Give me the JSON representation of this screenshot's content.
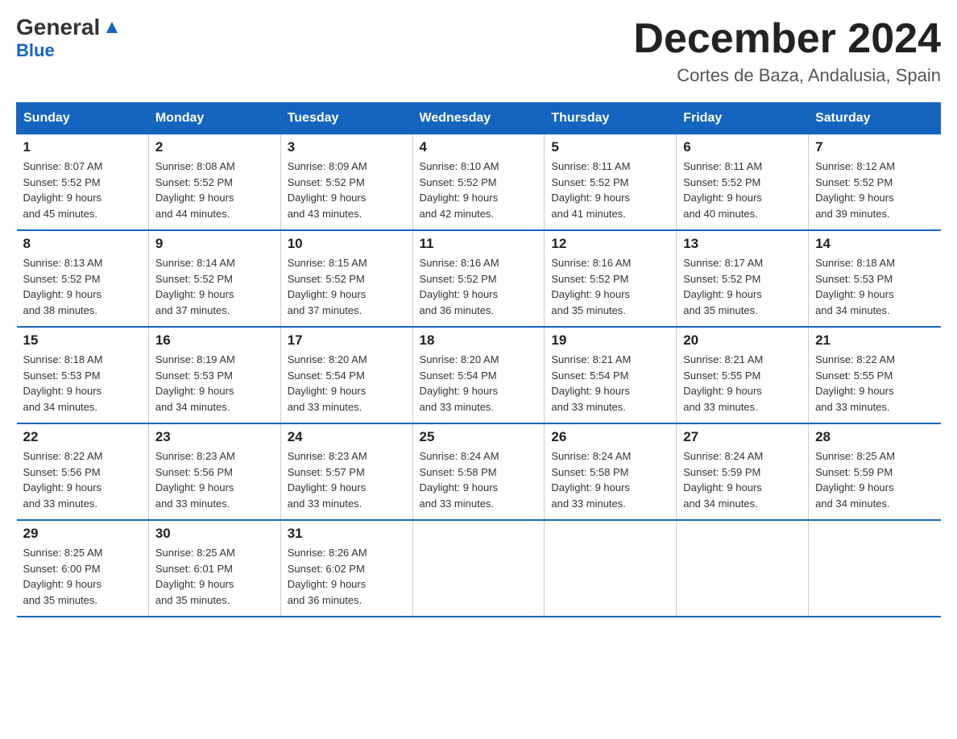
{
  "header": {
    "logo_line1": "General",
    "logo_line2": "Blue",
    "month": "December 2024",
    "location": "Cortes de Baza, Andalusia, Spain"
  },
  "days_of_week": [
    "Sunday",
    "Monday",
    "Tuesday",
    "Wednesday",
    "Thursday",
    "Friday",
    "Saturday"
  ],
  "weeks": [
    [
      {
        "day": "1",
        "info": "Sunrise: 8:07 AM\nSunset: 5:52 PM\nDaylight: 9 hours\nand 45 minutes."
      },
      {
        "day": "2",
        "info": "Sunrise: 8:08 AM\nSunset: 5:52 PM\nDaylight: 9 hours\nand 44 minutes."
      },
      {
        "day": "3",
        "info": "Sunrise: 8:09 AM\nSunset: 5:52 PM\nDaylight: 9 hours\nand 43 minutes."
      },
      {
        "day": "4",
        "info": "Sunrise: 8:10 AM\nSunset: 5:52 PM\nDaylight: 9 hours\nand 42 minutes."
      },
      {
        "day": "5",
        "info": "Sunrise: 8:11 AM\nSunset: 5:52 PM\nDaylight: 9 hours\nand 41 minutes."
      },
      {
        "day": "6",
        "info": "Sunrise: 8:11 AM\nSunset: 5:52 PM\nDaylight: 9 hours\nand 40 minutes."
      },
      {
        "day": "7",
        "info": "Sunrise: 8:12 AM\nSunset: 5:52 PM\nDaylight: 9 hours\nand 39 minutes."
      }
    ],
    [
      {
        "day": "8",
        "info": "Sunrise: 8:13 AM\nSunset: 5:52 PM\nDaylight: 9 hours\nand 38 minutes."
      },
      {
        "day": "9",
        "info": "Sunrise: 8:14 AM\nSunset: 5:52 PM\nDaylight: 9 hours\nand 37 minutes."
      },
      {
        "day": "10",
        "info": "Sunrise: 8:15 AM\nSunset: 5:52 PM\nDaylight: 9 hours\nand 37 minutes."
      },
      {
        "day": "11",
        "info": "Sunrise: 8:16 AM\nSunset: 5:52 PM\nDaylight: 9 hours\nand 36 minutes."
      },
      {
        "day": "12",
        "info": "Sunrise: 8:16 AM\nSunset: 5:52 PM\nDaylight: 9 hours\nand 35 minutes."
      },
      {
        "day": "13",
        "info": "Sunrise: 8:17 AM\nSunset: 5:52 PM\nDaylight: 9 hours\nand 35 minutes."
      },
      {
        "day": "14",
        "info": "Sunrise: 8:18 AM\nSunset: 5:53 PM\nDaylight: 9 hours\nand 34 minutes."
      }
    ],
    [
      {
        "day": "15",
        "info": "Sunrise: 8:18 AM\nSunset: 5:53 PM\nDaylight: 9 hours\nand 34 minutes."
      },
      {
        "day": "16",
        "info": "Sunrise: 8:19 AM\nSunset: 5:53 PM\nDaylight: 9 hours\nand 34 minutes."
      },
      {
        "day": "17",
        "info": "Sunrise: 8:20 AM\nSunset: 5:54 PM\nDaylight: 9 hours\nand 33 minutes."
      },
      {
        "day": "18",
        "info": "Sunrise: 8:20 AM\nSunset: 5:54 PM\nDaylight: 9 hours\nand 33 minutes."
      },
      {
        "day": "19",
        "info": "Sunrise: 8:21 AM\nSunset: 5:54 PM\nDaylight: 9 hours\nand 33 minutes."
      },
      {
        "day": "20",
        "info": "Sunrise: 8:21 AM\nSunset: 5:55 PM\nDaylight: 9 hours\nand 33 minutes."
      },
      {
        "day": "21",
        "info": "Sunrise: 8:22 AM\nSunset: 5:55 PM\nDaylight: 9 hours\nand 33 minutes."
      }
    ],
    [
      {
        "day": "22",
        "info": "Sunrise: 8:22 AM\nSunset: 5:56 PM\nDaylight: 9 hours\nand 33 minutes."
      },
      {
        "day": "23",
        "info": "Sunrise: 8:23 AM\nSunset: 5:56 PM\nDaylight: 9 hours\nand 33 minutes."
      },
      {
        "day": "24",
        "info": "Sunrise: 8:23 AM\nSunset: 5:57 PM\nDaylight: 9 hours\nand 33 minutes."
      },
      {
        "day": "25",
        "info": "Sunrise: 8:24 AM\nSunset: 5:58 PM\nDaylight: 9 hours\nand 33 minutes."
      },
      {
        "day": "26",
        "info": "Sunrise: 8:24 AM\nSunset: 5:58 PM\nDaylight: 9 hours\nand 33 minutes."
      },
      {
        "day": "27",
        "info": "Sunrise: 8:24 AM\nSunset: 5:59 PM\nDaylight: 9 hours\nand 34 minutes."
      },
      {
        "day": "28",
        "info": "Sunrise: 8:25 AM\nSunset: 5:59 PM\nDaylight: 9 hours\nand 34 minutes."
      }
    ],
    [
      {
        "day": "29",
        "info": "Sunrise: 8:25 AM\nSunset: 6:00 PM\nDaylight: 9 hours\nand 35 minutes."
      },
      {
        "day": "30",
        "info": "Sunrise: 8:25 AM\nSunset: 6:01 PM\nDaylight: 9 hours\nand 35 minutes."
      },
      {
        "day": "31",
        "info": "Sunrise: 8:26 AM\nSunset: 6:02 PM\nDaylight: 9 hours\nand 36 minutes."
      },
      {
        "day": "",
        "info": ""
      },
      {
        "day": "",
        "info": ""
      },
      {
        "day": "",
        "info": ""
      },
      {
        "day": "",
        "info": ""
      }
    ]
  ]
}
